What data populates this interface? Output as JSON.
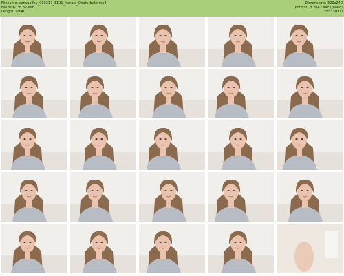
{
  "header": {
    "filename_label": "Filename:",
    "filename": "sensualfay_010217_1121_female_Chaturbate.mp4",
    "filesize_label": "File size:",
    "filesize": "36.32 MiB",
    "length_label": "Length:",
    "length": "09:40",
    "dimensions_label": "Dimensions:",
    "dimensions": "320x240",
    "format_label": "Format:",
    "format": "H.264 / aac (mono)",
    "fps_label": "FPS:",
    "fps": "30.00"
  },
  "colors": {
    "header_bg": "#a9cf7a",
    "hair": "#8b6a4d",
    "skin": "#e9c3ae",
    "shirt": "#b8bcc4",
    "background_wall": "#f1efec"
  },
  "thumbnails": [
    {
      "index": 1
    },
    {
      "index": 2
    },
    {
      "index": 3
    },
    {
      "index": 4
    },
    {
      "index": 5
    },
    {
      "index": 6
    },
    {
      "index": 7
    },
    {
      "index": 8
    },
    {
      "index": 9
    },
    {
      "index": 10
    },
    {
      "index": 11
    },
    {
      "index": 12
    },
    {
      "index": 13
    },
    {
      "index": 14
    },
    {
      "index": 15
    },
    {
      "index": 16
    },
    {
      "index": 17
    },
    {
      "index": 18
    },
    {
      "index": 19
    },
    {
      "index": 20
    },
    {
      "index": 21
    },
    {
      "index": 22
    },
    {
      "index": 23
    },
    {
      "index": 24
    },
    {
      "index": 25
    }
  ]
}
